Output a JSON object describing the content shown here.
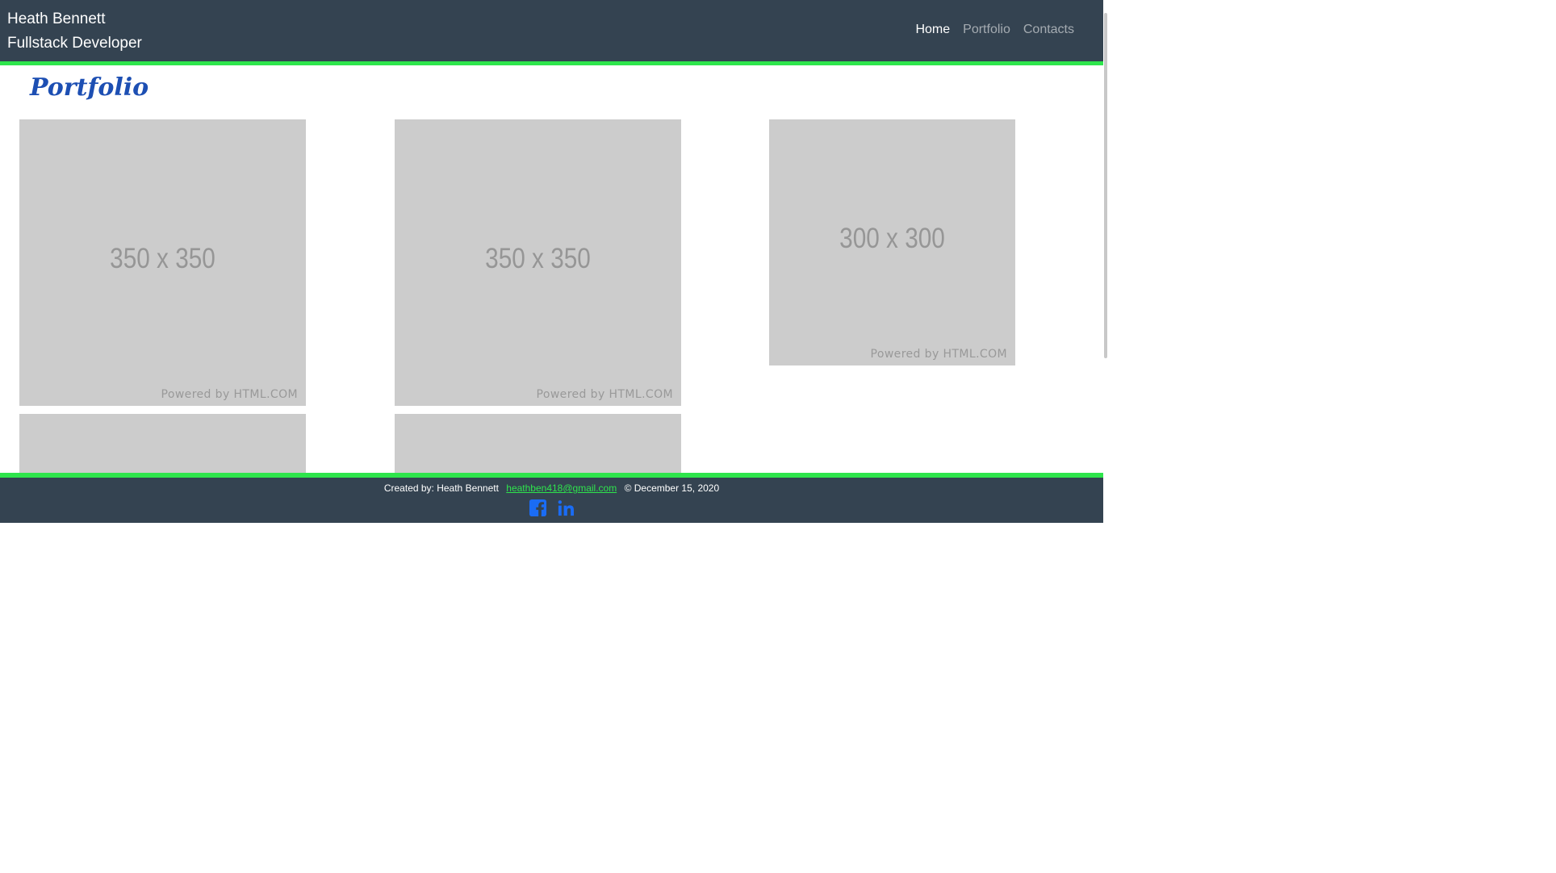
{
  "header": {
    "name": "Heath Bennett",
    "role": "Fullstack Developer",
    "nav": [
      {
        "label": "Home"
      },
      {
        "label": "Portfolio"
      },
      {
        "label": "Contacts"
      }
    ]
  },
  "main": {
    "title": "Portfolio",
    "cards": [
      {
        "dimension": "350 x 350",
        "powered": "Powered by HTML.COM"
      },
      {
        "dimension": "350 x 350",
        "powered": "Powered by HTML.COM"
      },
      {
        "dimension": "300 x 300",
        "powered": "Powered by HTML.COM"
      }
    ]
  },
  "footer": {
    "created": "Created by: Heath Bennett",
    "email": "heathben418@gmail.com",
    "copyright": "© December 15, 2020"
  },
  "colors": {
    "navbar": "#344351",
    "accent_green": "#2ee54c",
    "title_blue": "#1d4fb3",
    "placeholder_gray": "#cccccc",
    "icon_blue": "#1a6cf5"
  }
}
